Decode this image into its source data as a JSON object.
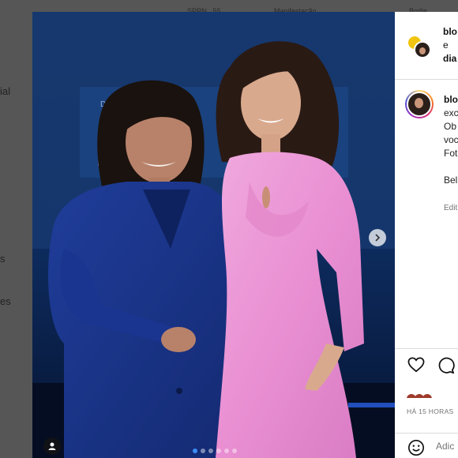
{
  "background": {
    "topnav": [
      "SPRN...55",
      "Manifestação",
      "Bodie..."
    ],
    "sidebar": [
      "ial",
      "s",
      "es"
    ]
  },
  "post": {
    "header": {
      "names": [
        "blo",
        "e",
        "dia"
      ]
    },
    "caption": {
      "user": "blo",
      "lines": [
        "exc",
        "Ob",
        "voc",
        "Fot"
      ],
      "extra": "Bel",
      "edit": "Edit"
    },
    "photo": {
      "alt": "",
      "carousel_count": 6,
      "carousel_active": 0
    },
    "time": "HÁ 15 HORAS",
    "comment_placeholder": "Adic",
    "icons": {
      "like": "heart-icon",
      "comment": "comment-icon",
      "emoji": "emoji-icon",
      "next": "chevron-right-icon",
      "tag": "user-tag-icon"
    },
    "colors": {
      "accent": "#3d8df5",
      "text": "#111111",
      "muted": "#737373"
    }
  }
}
